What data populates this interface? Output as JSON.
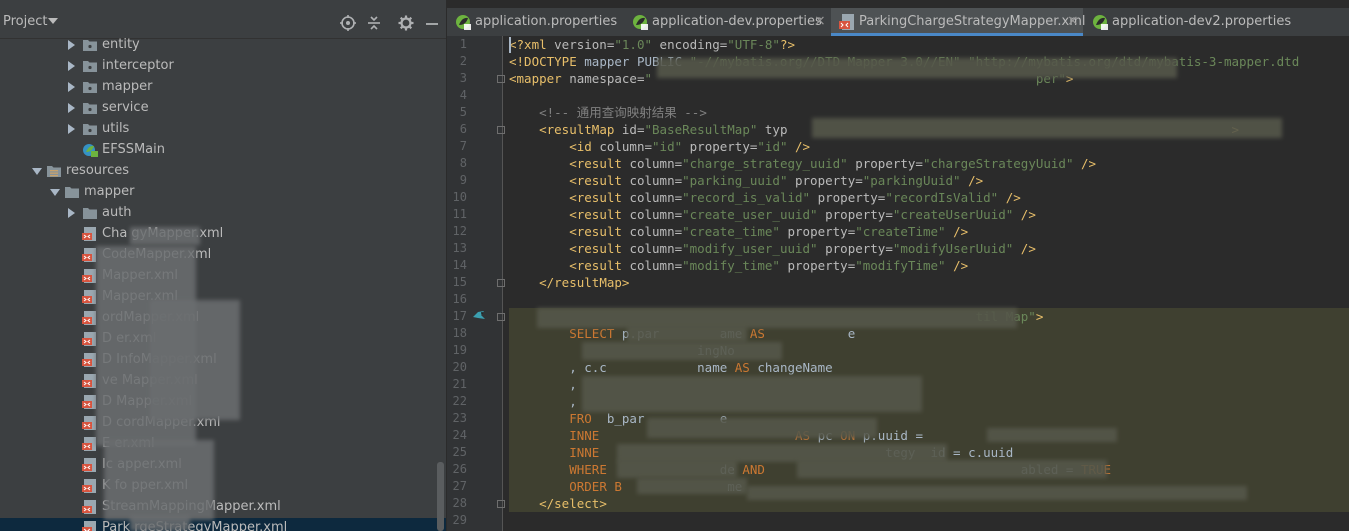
{
  "project": {
    "title": "Project",
    "tree": [
      {
        "label": "entity",
        "type": "package",
        "indent": 1,
        "expanded": false
      },
      {
        "label": "interceptor",
        "type": "package",
        "indent": 1,
        "expanded": false
      },
      {
        "label": "mapper",
        "type": "package",
        "indent": 1,
        "expanded": false
      },
      {
        "label": "service",
        "type": "package",
        "indent": 1,
        "expanded": false
      },
      {
        "label": "utils",
        "type": "package",
        "indent": 1,
        "expanded": false
      },
      {
        "label": "EFSSMain",
        "type": "spring-class",
        "indent": 1
      },
      {
        "label": "resources",
        "type": "resources-folder",
        "indent": 0,
        "expanded": true
      },
      {
        "label": "mapper",
        "type": "folder",
        "indent": 0.5,
        "expanded": true
      },
      {
        "label": "auth",
        "type": "folder",
        "indent": 1,
        "expanded": false
      },
      {
        "label": "Cha      gyMapper.xml",
        "type": "xml",
        "indent": 1
      },
      {
        "label": "CodeMapper.xml",
        "type": "xml",
        "indent": 1
      },
      {
        "label": "Mapper.xml",
        "type": "xml",
        "indent": 1
      },
      {
        "label": "Mapper.xml",
        "type": "xml",
        "indent": 1
      },
      {
        "label": "ordMapper.xml",
        "type": "xml",
        "indent": 1
      },
      {
        "label": "D            er.xml",
        "type": "xml",
        "indent": 1
      },
      {
        "label": "D              InfoMapper.xml",
        "type": "xml",
        "indent": 1
      },
      {
        "label": "ve          Mapper.xml",
        "type": "xml",
        "indent": 1
      },
      {
        "label": "D                   Mapper.xml",
        "type": "xml",
        "indent": 1
      },
      {
        "label": "D                  cordMapper.xml",
        "type": "xml",
        "indent": 1
      },
      {
        "label": "E                 er.xml",
        "type": "xml",
        "indent": 1
      },
      {
        "label": "Ic                 apper.xml",
        "type": "xml",
        "indent": 1
      },
      {
        "label": "K              fo   pper.xml",
        "type": "xml",
        "indent": 1
      },
      {
        "label": "StreamMappingMapper.xml",
        "type": "xml",
        "indent": 1
      },
      {
        "label": "Park      rgeStrategyMapper.xml",
        "type": "xml",
        "indent": 1,
        "selected": true
      }
    ]
  },
  "tabs": [
    {
      "label": "application.properties",
      "icon": "spring-properties-icon",
      "active": false,
      "closable": false
    },
    {
      "label": "application-dev.properties",
      "icon": "spring-properties-icon",
      "active": false,
      "closable": true
    },
    {
      "label": "ParkingChargeStrategyMapper.xml",
      "icon": "xml-file-icon",
      "active": true,
      "closable": true
    },
    {
      "label": "application-dev2.properties",
      "icon": "spring-properties-icon",
      "active": false,
      "closable": false
    }
  ],
  "editor": {
    "line_numbers": [
      "1",
      "2",
      "3",
      "4",
      "5",
      "6",
      "7",
      "8",
      "9",
      "10",
      "11",
      "12",
      "13",
      "14",
      "15",
      "16",
      "17",
      "18",
      "19",
      "20",
      "21",
      "22",
      "23",
      "24",
      "25",
      "26",
      "27",
      "28",
      "29"
    ],
    "lines": [
      [
        [
          "t-tag",
          "<?xml "
        ],
        [
          "t-attr",
          "version="
        ],
        [
          "t-val",
          "\"1.0\""
        ],
        [
          "t-attr",
          " encoding="
        ],
        [
          "t-val",
          "\"UTF-8\""
        ],
        [
          "t-tag",
          "?>"
        ]
      ],
      [
        [
          "t-dt",
          "<!DOCTYPE "
        ],
        [
          "t-text",
          "mapper PUBLIC "
        ],
        [
          "t-val",
          "\"-//mybatis.org//DTD Mapper 3.0//EN\""
        ],
        [
          "t-text",
          " "
        ],
        [
          "t-val",
          "\"http://mybatis.org/dtd/mybatis-3-mapper.dtd"
        ]
      ],
      [
        [
          "t-tag",
          "<mapper "
        ],
        [
          "t-attr",
          "namespace="
        ],
        [
          "t-val",
          "\"                                                   per\""
        ],
        [
          "t-tag",
          ">"
        ]
      ],
      [],
      [
        [
          "t-text",
          "    "
        ],
        [
          "t-cmt",
          "<!-- 通用查询映射结果 -->"
        ]
      ],
      [
        [
          "t-text",
          "    "
        ],
        [
          "t-tag",
          "<resultMap "
        ],
        [
          "t-attr",
          "id="
        ],
        [
          "t-val",
          "\"BaseResultMap\""
        ],
        [
          "t-attr",
          " typ"
        ],
        [
          "t-text",
          "                                                           "
        ],
        [
          "t-tag",
          ">"
        ]
      ],
      [
        [
          "t-text",
          "        "
        ],
        [
          "t-tag",
          "<id "
        ],
        [
          "t-attr",
          "column="
        ],
        [
          "t-val",
          "\"id\""
        ],
        [
          "t-attr",
          " property="
        ],
        [
          "t-val",
          "\"id\""
        ],
        [
          "t-tag",
          " />"
        ]
      ],
      [
        [
          "t-text",
          "        "
        ],
        [
          "t-tag",
          "<result "
        ],
        [
          "t-attr",
          "column="
        ],
        [
          "t-val",
          "\"charge_strategy_uuid\""
        ],
        [
          "t-attr",
          " property="
        ],
        [
          "t-val",
          "\"chargeStrategyUuid\""
        ],
        [
          "t-tag",
          " />"
        ]
      ],
      [
        [
          "t-text",
          "        "
        ],
        [
          "t-tag",
          "<result "
        ],
        [
          "t-attr",
          "column="
        ],
        [
          "t-val",
          "\"parking_uuid\""
        ],
        [
          "t-attr",
          " property="
        ],
        [
          "t-val",
          "\"parkingUuid\""
        ],
        [
          "t-tag",
          " />"
        ]
      ],
      [
        [
          "t-text",
          "        "
        ],
        [
          "t-tag",
          "<result "
        ],
        [
          "t-attr",
          "column="
        ],
        [
          "t-val",
          "\"record_is_valid\""
        ],
        [
          "t-attr",
          " property="
        ],
        [
          "t-val",
          "\"recordIsValid\""
        ],
        [
          "t-tag",
          " />"
        ]
      ],
      [
        [
          "t-text",
          "        "
        ],
        [
          "t-tag",
          "<result "
        ],
        [
          "t-attr",
          "column="
        ],
        [
          "t-val",
          "\"create_user_uuid\""
        ],
        [
          "t-attr",
          " property="
        ],
        [
          "t-val",
          "\"createUserUuid\""
        ],
        [
          "t-tag",
          " />"
        ]
      ],
      [
        [
          "t-text",
          "        "
        ],
        [
          "t-tag",
          "<result "
        ],
        [
          "t-attr",
          "column="
        ],
        [
          "t-val",
          "\"create_time\""
        ],
        [
          "t-attr",
          " property="
        ],
        [
          "t-val",
          "\"createTime\""
        ],
        [
          "t-tag",
          " />"
        ]
      ],
      [
        [
          "t-text",
          "        "
        ],
        [
          "t-tag",
          "<result "
        ],
        [
          "t-attr",
          "column="
        ],
        [
          "t-val",
          "\"modify_user_uuid\""
        ],
        [
          "t-attr",
          " property="
        ],
        [
          "t-val",
          "\"modifyUserUuid\""
        ],
        [
          "t-tag",
          " />"
        ]
      ],
      [
        [
          "t-text",
          "        "
        ],
        [
          "t-tag",
          "<result "
        ],
        [
          "t-attr",
          "column="
        ],
        [
          "t-val",
          "\"modify_time\""
        ],
        [
          "t-attr",
          " property="
        ],
        [
          "t-val",
          "\"modifyTime\""
        ],
        [
          "t-tag",
          " />"
        ]
      ],
      [
        [
          "t-text",
          "    "
        ],
        [
          "t-tag",
          "</resultMap>"
        ]
      ],
      [],
      [
        [
          "t-text",
          "                                                              "
        ],
        [
          "t-val",
          "til Map\""
        ],
        [
          "t-tag",
          ">"
        ]
      ],
      [
        [
          "t-text",
          "        "
        ],
        [
          "t-kw",
          "SELECT "
        ],
        [
          "t-text",
          "p.par        ame "
        ],
        [
          "t-kw",
          "AS"
        ],
        [
          "t-text",
          "           e"
        ]
      ],
      [
        [
          "t-text",
          "                         ingNo"
        ]
      ],
      [
        [
          "t-text",
          "        , c.c            name "
        ],
        [
          "t-kw",
          "AS"
        ],
        [
          "t-text",
          " changeName"
        ]
      ],
      [
        [
          "t-text",
          "        ,"
        ]
      ],
      [
        [
          "t-text",
          "        ,"
        ]
      ],
      [
        [
          "t-text",
          "        "
        ],
        [
          "t-kw",
          "FRO"
        ],
        [
          "t-text",
          "  b_par          e"
        ]
      ],
      [
        [
          "t-text",
          "        "
        ],
        [
          "t-kw",
          "INNE"
        ],
        [
          "t-text",
          "                          "
        ],
        [
          "t-kw",
          "AS"
        ],
        [
          "t-text",
          " pc "
        ],
        [
          "t-kw",
          "ON"
        ],
        [
          "t-text",
          " p.uuid ="
        ]
      ],
      [
        [
          "t-text",
          "        "
        ],
        [
          "t-kw",
          "INNE"
        ],
        [
          "t-text",
          "                                      tegy  id = c.uuid"
        ]
      ],
      [
        [
          "t-text",
          "        "
        ],
        [
          "t-kw",
          "WHERE"
        ],
        [
          "t-text",
          "               de "
        ],
        [
          "t-kw",
          "AND"
        ],
        [
          "t-text",
          "                                  abled = "
        ],
        [
          "t-kw",
          "TRUE"
        ]
      ],
      [
        [
          "t-text",
          "        "
        ],
        [
          "t-kw",
          "ORDER B"
        ],
        [
          "t-text",
          "              me"
        ]
      ],
      [
        [
          "t-text",
          "    "
        ],
        [
          "t-tag",
          "</select>"
        ]
      ],
      []
    ]
  }
}
